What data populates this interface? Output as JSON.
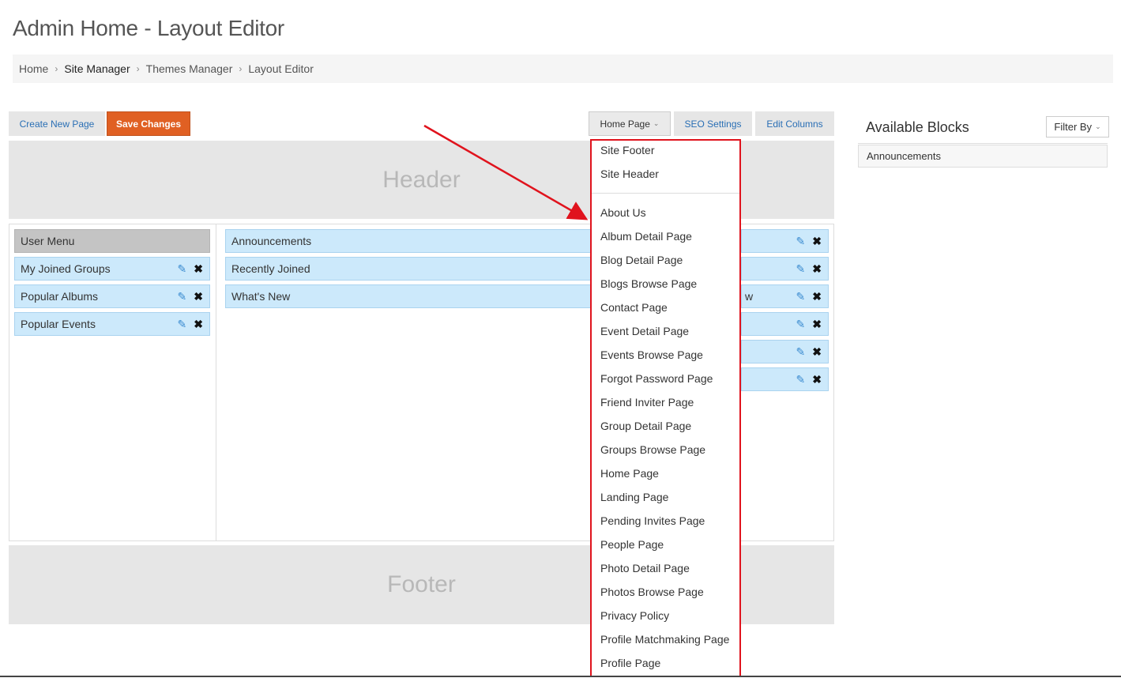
{
  "page": {
    "title": "Admin Home - Layout Editor"
  },
  "breadcrumb": [
    "Home",
    "Site Manager",
    "Themes Manager",
    "Layout Editor"
  ],
  "toolbar": {
    "create_new_page": "Create New Page",
    "save_changes": "Save Changes",
    "page_select": "Home Page",
    "seo_settings": "SEO Settings",
    "edit_columns": "Edit Columns"
  },
  "zones": {
    "header": "Header",
    "footer": "Footer"
  },
  "left_column": {
    "title": "User Menu",
    "blocks": [
      "My Joined Groups",
      "Popular Albums",
      "Popular Events"
    ]
  },
  "middle_column": {
    "blocks": [
      "Announcements",
      "Recently Joined",
      "What's New"
    ]
  },
  "right_column": {
    "partial_text": "w"
  },
  "dropdown": {
    "system_pages": [
      "Site Footer",
      "Site Header"
    ],
    "pages": [
      "About Us",
      "Album Detail Page",
      "Blog Detail Page",
      "Blogs Browse Page",
      "Contact Page",
      "Event Detail Page",
      "Events Browse Page",
      "Forgot Password Page",
      "Friend Inviter Page",
      "Group Detail Page",
      "Groups Browse Page",
      "Home Page",
      "Landing Page",
      "Pending Invites Page",
      "People Page",
      "Photo Detail Page",
      "Photos Browse Page",
      "Privacy Policy",
      "Profile Matchmaking Page",
      "Profile Page"
    ]
  },
  "available_blocks": {
    "title": "Available Blocks",
    "filter_label": "Filter By",
    "items": [
      "Announcements"
    ]
  },
  "icons": {
    "edit": "pencil-icon",
    "remove": "close-icon",
    "caret": "chevron-down-icon",
    "separator": "chevron-right-icon"
  },
  "colors": {
    "save_button": "#e06023",
    "block_bg": "#cce9fb",
    "annotation": "#e0131d",
    "link": "#2a6fb5"
  }
}
